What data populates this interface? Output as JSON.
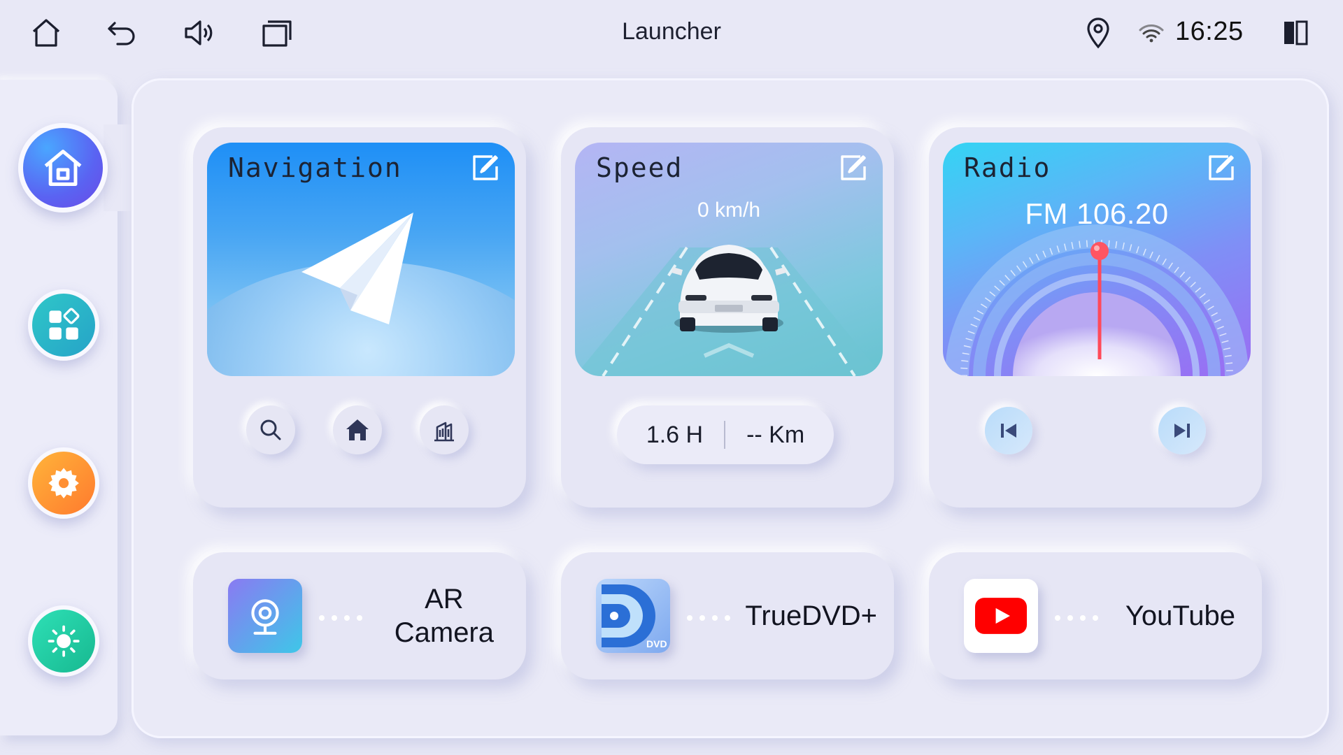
{
  "status_bar": {
    "title": "Launcher",
    "time": "16:25"
  },
  "sidebar": {
    "items": [
      {
        "name": "home",
        "active": true
      },
      {
        "name": "apps",
        "active": false
      },
      {
        "name": "settings",
        "active": false
      },
      {
        "name": "brightness",
        "active": false
      }
    ]
  },
  "widgets": {
    "navigation": {
      "title": "Navigation"
    },
    "speed": {
      "title": "Speed",
      "speed": "0 km/h",
      "duration": "1.6 H",
      "distance": "-- Km"
    },
    "radio": {
      "title": "Radio",
      "frequency": "FM 106.20"
    }
  },
  "apps": [
    {
      "label_line1": "AR",
      "label_line2": "Camera",
      "icon": "webcam-icon"
    },
    {
      "label": "TrueDVD+",
      "icon": "dvd-icon",
      "icon_text": "DVD"
    },
    {
      "label": "YouTube",
      "icon": "youtube-icon"
    }
  ],
  "colors": {
    "background": "#e8e8f6",
    "accent": "#5a63f2",
    "youtube_red": "#ff0000",
    "radio_needle": "#ff4a5a"
  }
}
